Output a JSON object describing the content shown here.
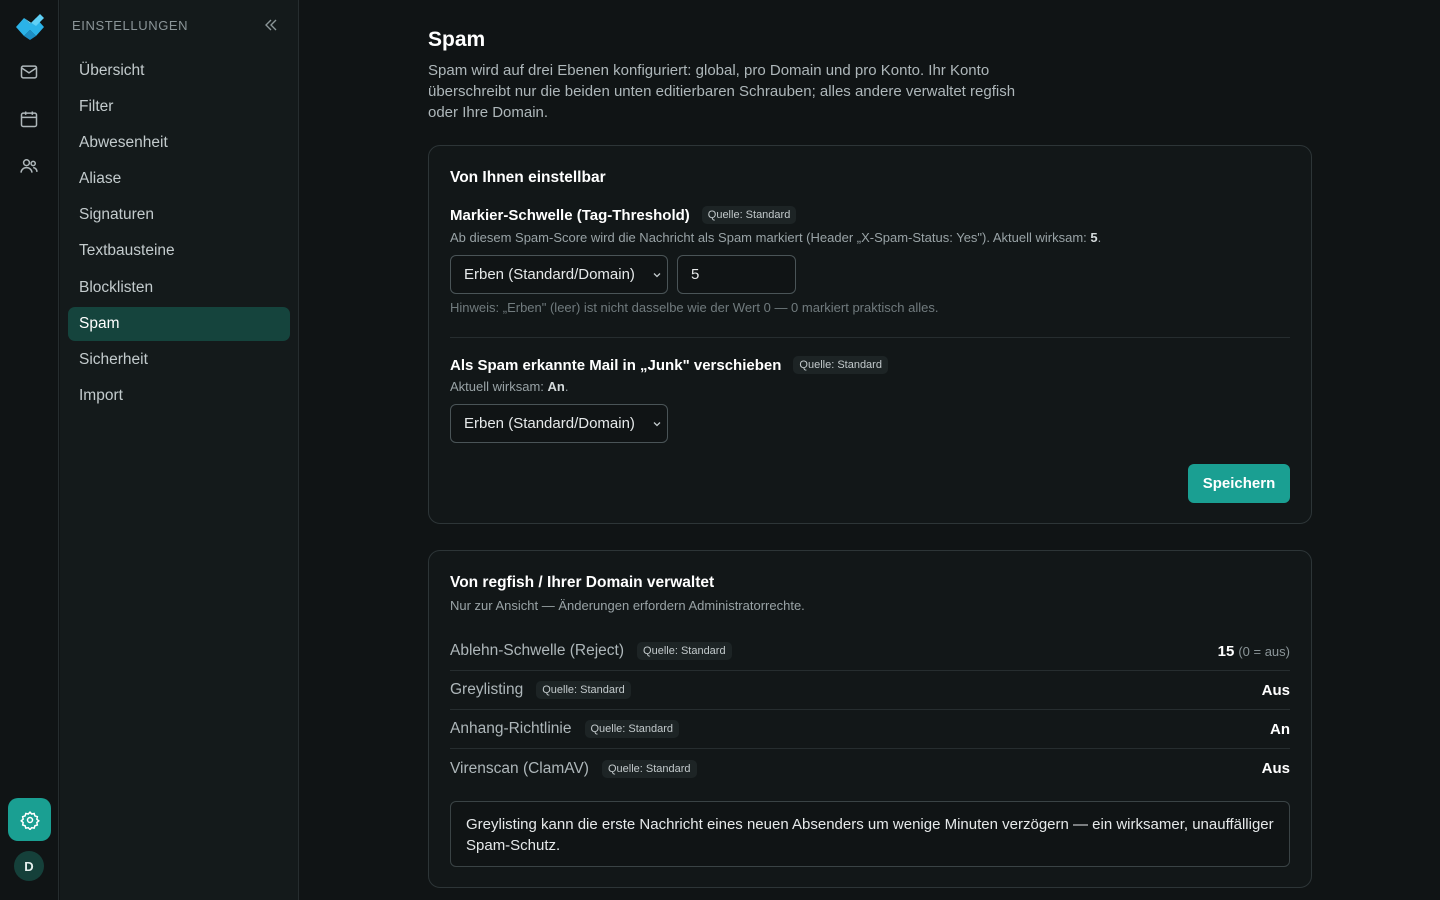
{
  "rail": {
    "icons": [
      "logo-icon",
      "mail-icon",
      "calendar-icon",
      "contacts-icon",
      "gear-icon"
    ],
    "avatar_initial": "D",
    "accent_color": "#1a9f92"
  },
  "sidebar": {
    "header": "EINSTELLUNGEN",
    "items": [
      {
        "label": "Übersicht"
      },
      {
        "label": "Filter"
      },
      {
        "label": "Abwesenheit"
      },
      {
        "label": "Aliase"
      },
      {
        "label": "Signaturen"
      },
      {
        "label": "Textbausteine"
      },
      {
        "label": "Blocklisten"
      },
      {
        "label": "Spam",
        "active": true
      },
      {
        "label": "Sicherheit"
      },
      {
        "label": "Import"
      }
    ]
  },
  "page": {
    "title": "Spam",
    "description": "Spam wird auf drei Ebenen konfiguriert: global, pro Domain und pro Konto. Ihr Konto überschreibt nur die beiden unten editierbaren Schrauben; alles andere verwaltet regfish oder Ihre Domain."
  },
  "editable": {
    "title": "Von Ihnen einstellbar",
    "threshold": {
      "label": "Markier-Schwelle (Tag-Threshold)",
      "source": "Quelle: Standard",
      "help_prefix": "Ab diesem Spam-Score wird die Nachricht als Spam markiert (Header „X-Spam-Status: Yes\"). Aktuell wirksam: ",
      "help_value": "5",
      "help_suffix": ".",
      "select_value": "Erben (Standard/Domain)",
      "input_value": "5",
      "hint": "Hinweis: „Erben\" (leer) ist nicht dasselbe wie der Wert 0 — 0 markiert praktisch alles."
    },
    "junk": {
      "label": "Als Spam erkannte Mail in „Junk\" verschieben",
      "source": "Quelle: Standard",
      "help_prefix": "Aktuell wirksam: ",
      "help_value": "An",
      "help_suffix": ".",
      "select_value": "Erben (Standard/Domain)"
    },
    "save_label": "Speichern"
  },
  "managed": {
    "title": "Von regfish / Ihrer Domain verwaltet",
    "subtitle": "Nur zur Ansicht — Änderungen erfordern Administratorrechte.",
    "rows": [
      {
        "label": "Ablehn-Schwelle (Reject)",
        "source": "Quelle: Standard",
        "value": "15",
        "suffix": "(0 = aus)"
      },
      {
        "label": "Greylisting",
        "source": "Quelle: Standard",
        "value": "Aus",
        "suffix": ""
      },
      {
        "label": "Anhang-Richtlinie",
        "source": "Quelle: Standard",
        "value": "An",
        "suffix": ""
      },
      {
        "label": "Virenscan (ClamAV)",
        "source": "Quelle: Standard",
        "value": "Aus",
        "suffix": ""
      }
    ],
    "info": "Greylisting kann die erste Nachricht eines neuen Absenders um wenige Minuten verzögern — ein wirksamer, unauffälliger Spam-Schutz."
  }
}
